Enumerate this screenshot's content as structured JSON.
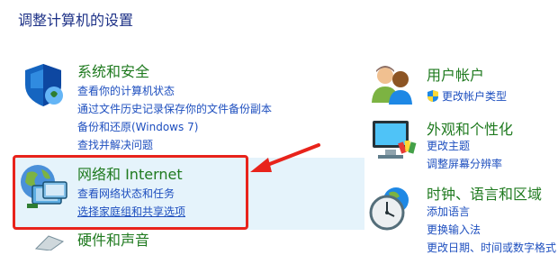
{
  "page": {
    "title": "调整计算机的设置"
  },
  "left": {
    "security": {
      "title": "系统和安全",
      "links": [
        "查看你的计算机状态",
        "通过文件历史记录保存你的文件备份副本",
        "备份和还原(Windows 7)",
        "查找并解决问题"
      ]
    },
    "network": {
      "title": "网络和 Internet",
      "links": [
        "查看网络状态和任务",
        "选择家庭组和共享选项"
      ]
    },
    "hardware": {
      "title": "硬件和声音"
    }
  },
  "right": {
    "accounts": {
      "title": "用户帐户",
      "links": [
        "更改帐户类型"
      ]
    },
    "appearance": {
      "title": "外观和个性化",
      "links": [
        "更改主题",
        "调整屏幕分辨率"
      ]
    },
    "clock": {
      "title": "时钟、语言和区域",
      "links": [
        "添加语言",
        "更换输入法",
        "更改日期、时间或数字格式"
      ]
    }
  },
  "colors": {
    "category": "#1f7a1f",
    "link": "#1e4fbf",
    "highlight": "#e5f3fb",
    "annotation": "#e8231b"
  }
}
